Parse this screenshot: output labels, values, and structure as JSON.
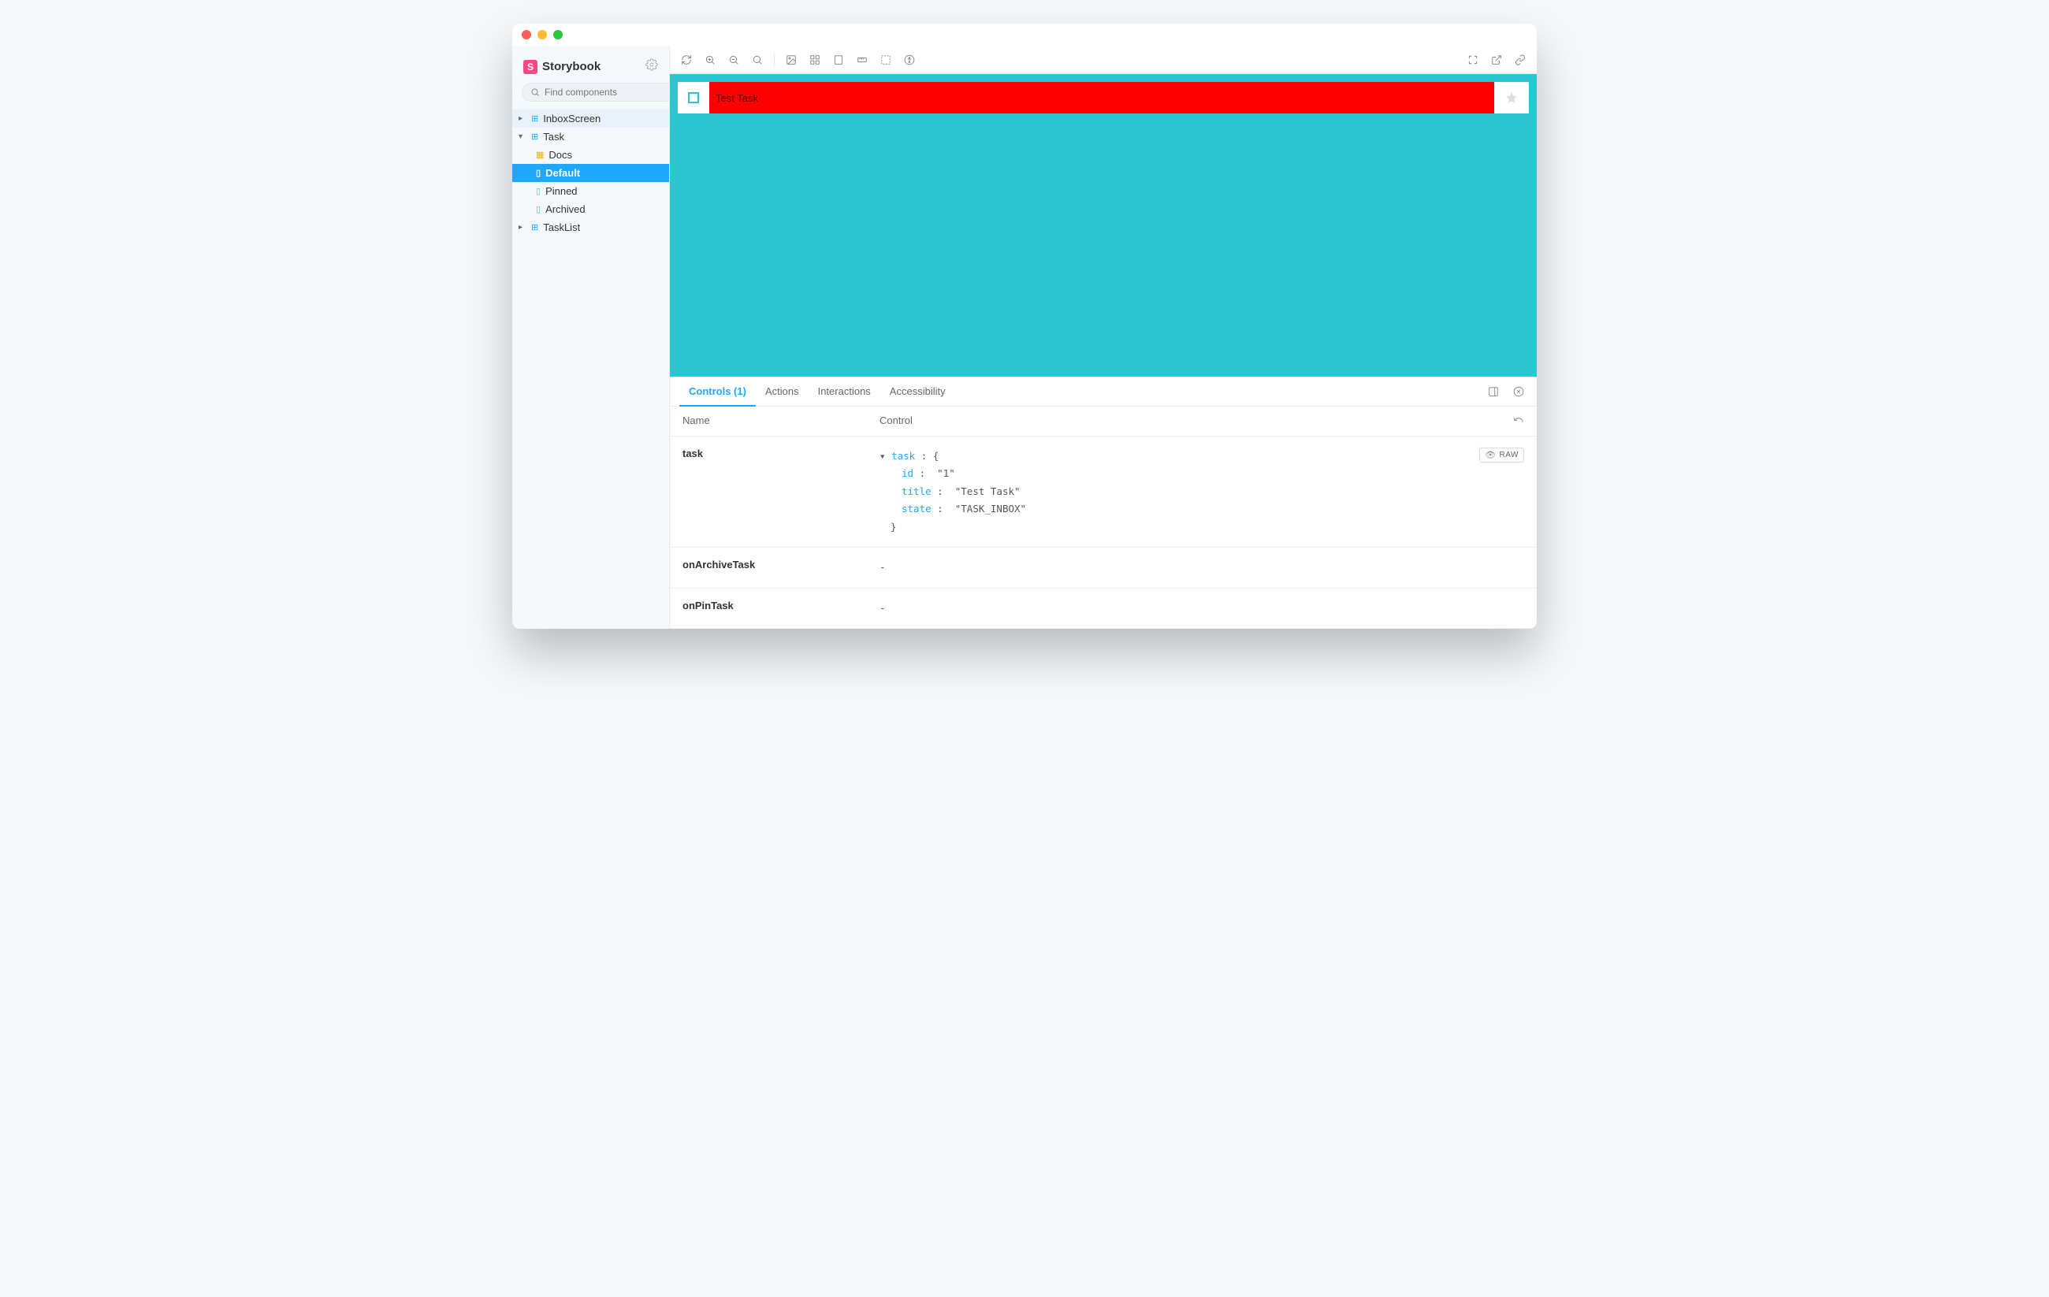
{
  "brand": {
    "name": "Storybook",
    "logo_letter": "S"
  },
  "search": {
    "placeholder": "Find components",
    "shortcut": "/"
  },
  "sidebar": {
    "items": [
      {
        "label": "InboxScreen"
      },
      {
        "label": "Task"
      },
      {
        "label": "Docs"
      },
      {
        "label": "Default"
      },
      {
        "label": "Pinned"
      },
      {
        "label": "Archived"
      },
      {
        "label": "TaskList"
      }
    ]
  },
  "canvas": {
    "task_title": "Test Task"
  },
  "addon_tabs": {
    "controls": "Controls (1)",
    "actions": "Actions",
    "interactions": "Interactions",
    "accessibility": "Accessibility"
  },
  "controls": {
    "head_name": "Name",
    "head_control": "Control",
    "raw_label": "RAW",
    "rows": [
      {
        "name": "task",
        "json_root": "task",
        "fields": [
          {
            "key": "id",
            "value": "\"1\""
          },
          {
            "key": "title",
            "value": "\"Test Task\""
          },
          {
            "key": "state",
            "value": "\"TASK_INBOX\""
          }
        ]
      },
      {
        "name": "onArchiveTask",
        "dash": "-"
      },
      {
        "name": "onPinTask",
        "dash": "-"
      }
    ]
  }
}
